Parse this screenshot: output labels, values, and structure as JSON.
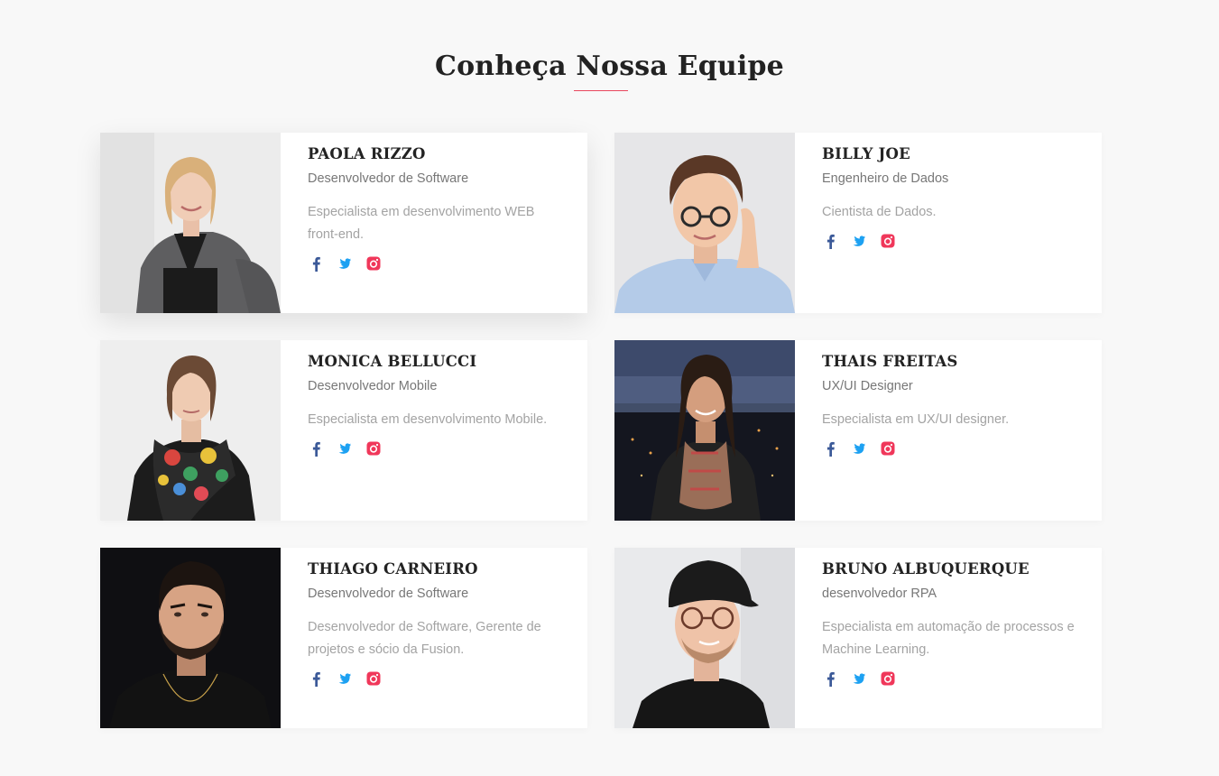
{
  "section": {
    "title": "Conheça Nossa Equipe",
    "accent_color": "#e8465d"
  },
  "social_icons": {
    "facebook": {
      "icon": "facebook-icon",
      "color": "#3b5998"
    },
    "twitter": {
      "icon": "twitter-icon",
      "color": "#1da1f2"
    },
    "instagram": {
      "icon": "instagram-icon",
      "color": "#f0375a"
    }
  },
  "team": [
    {
      "name": "PAOLA RIZZO",
      "role": "Desenvolvedor de Software",
      "description": "Especialista em desenvolvimento WEB front-end.",
      "photo": "portrait-woman-blonde-grey-cardigan"
    },
    {
      "name": "BILLY JOE",
      "role": "Engenheiro de Dados",
      "description": "Cientista de Dados.",
      "photo": "portrait-man-glasses-blue-shirt"
    },
    {
      "name": "MONICA BELLUCCI",
      "role": "Desenvolvedor Mobile",
      "description": "Especialista em desenvolvimento Mobile.",
      "photo": "portrait-woman-floral-scarf"
    },
    {
      "name": "THAIS FREITAS",
      "role": "UX/UI Designer",
      "description": "Especialista em UX/UI designer.",
      "photo": "portrait-woman-night-city"
    },
    {
      "name": "THIAGO CARNEIRO",
      "role": "Desenvolvedor de Software",
      "description": "Desenvolvedor de Software, Gerente de projetos e sócio da Fusion.",
      "photo": "portrait-man-beard-dark-background"
    },
    {
      "name": "BRUNO ALBUQUERQUE",
      "role": "desenvolvedor RPA",
      "description": "Especialista em automação de processos e Machine Learning.",
      "photo": "portrait-man-cap-glasses"
    }
  ]
}
